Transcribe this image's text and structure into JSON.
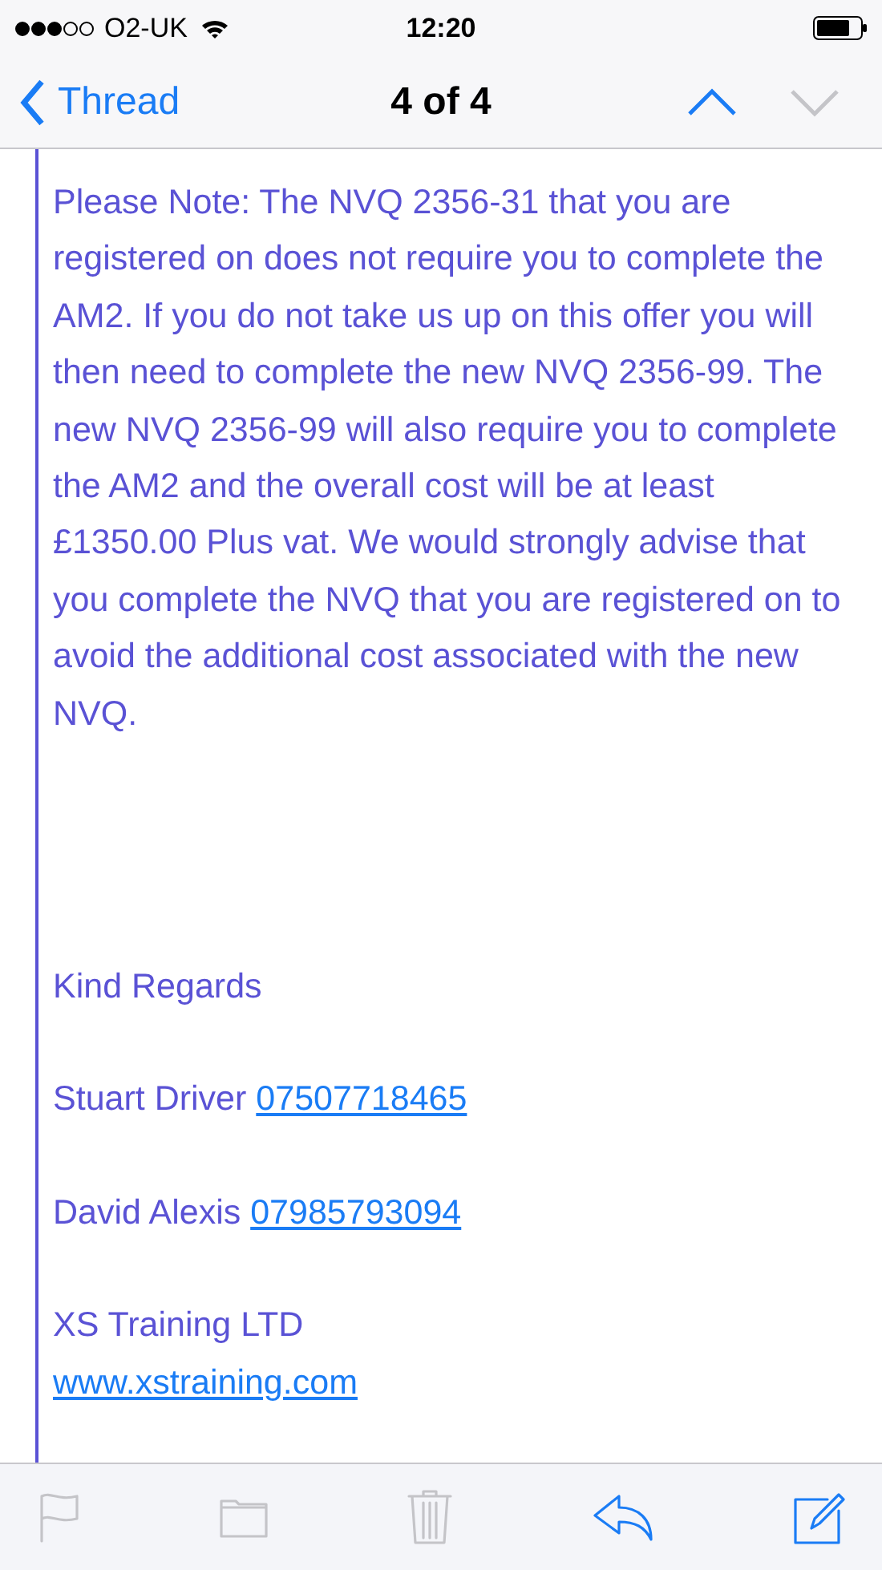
{
  "status_bar": {
    "carrier": "O2-UK",
    "time": "12:20"
  },
  "nav": {
    "back": "Thread",
    "title": "4 of 4",
    "buttons": [
      {
        "kind": "up",
        "disabled": false
      },
      {
        "kind": "down",
        "disabled": true
      }
    ]
  },
  "email": {
    "paragraph": "Please Note: The NVQ 2356-31 that you are registered on does not require you to complete the AM2. If you do not take us up on this offer you will then need to complete the new NVQ 2356-99. The new NVQ 2356-99 will also require you to complete the AM2 and the overall cost will be at least £1350.00 Plus vat. We would strongly advise that you complete the NVQ that you are registered on to avoid the additional cost associated with the new NVQ.",
    "closing": "Kind Regards",
    "contacts": [
      {
        "name": "Stuart Driver",
        "phone": "07507718465"
      },
      {
        "name": "David Alexis",
        "phone": "07985793094"
      }
    ],
    "company": "XS Training LTD",
    "website": "www.xstraining.com"
  },
  "toolbar": [
    {
      "kind": "flag",
      "disabled": true
    },
    {
      "kind": "folder",
      "disabled": true
    },
    {
      "kind": "trash",
      "disabled": true
    },
    {
      "kind": "reply",
      "disabled": false
    },
    {
      "kind": "compose",
      "disabled": false
    }
  ]
}
